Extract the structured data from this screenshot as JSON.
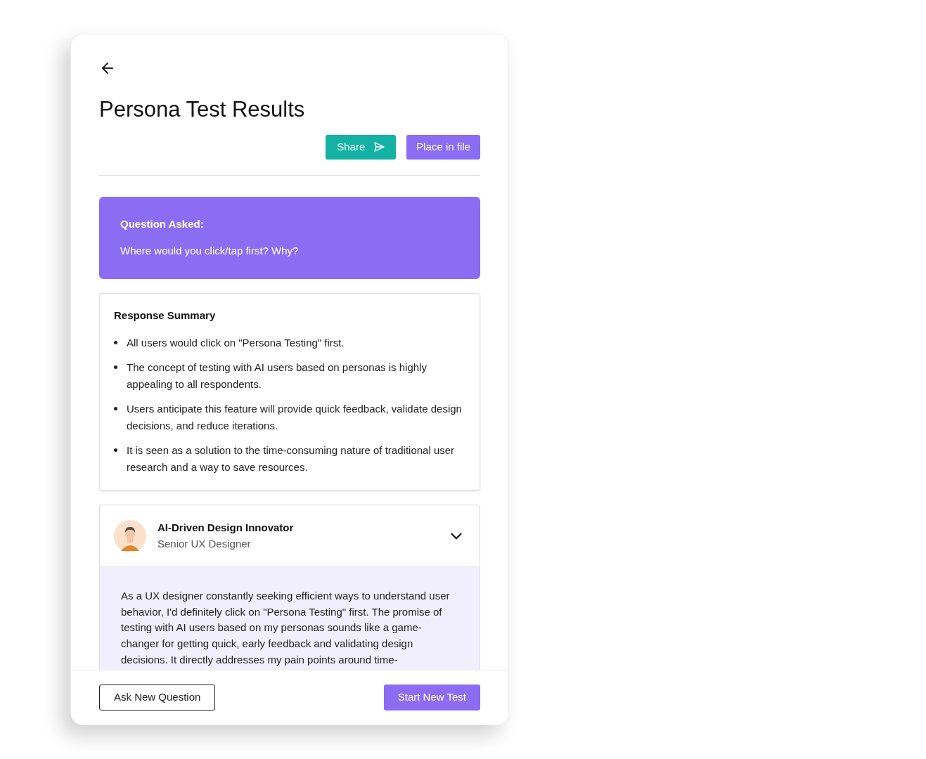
{
  "title": "Persona Test Results",
  "actions": [
    {
      "label": "Share",
      "kind": "share"
    },
    {
      "label": "Place in file",
      "kind": "place"
    }
  ],
  "question": {
    "heading": "Question Asked:",
    "text": "Where would you click/tap first? Why?"
  },
  "summary": {
    "heading": "Response Summary",
    "points": [
      "All users would click on \"Persona Testing\" first.",
      "The concept of testing with AI users based on personas is highly appealing to all respondents.",
      "Users anticipate this feature will provide quick feedback, validate design decisions, and reduce iterations.",
      "It is seen as a solution to the time-consuming nature of traditional user research and a way to save resources."
    ]
  },
  "personas": [
    {
      "name": "AI-Driven Design Innovator",
      "role": "Senior UX Designer",
      "expanded": true,
      "response": "As a UX designer constantly seeking efficient ways to understand user behavior, I'd definitely click on \"Persona Testing\" first. The promise of testing with AI users based on my personas sounds like a game-changer for getting quick, early feedback and validating design decisions. It directly addresses my pain points around time-"
    }
  ],
  "footer": [
    {
      "label": "Ask New Question",
      "kind": "outline"
    },
    {
      "label": "Start New Test",
      "kind": "primary"
    }
  ]
}
